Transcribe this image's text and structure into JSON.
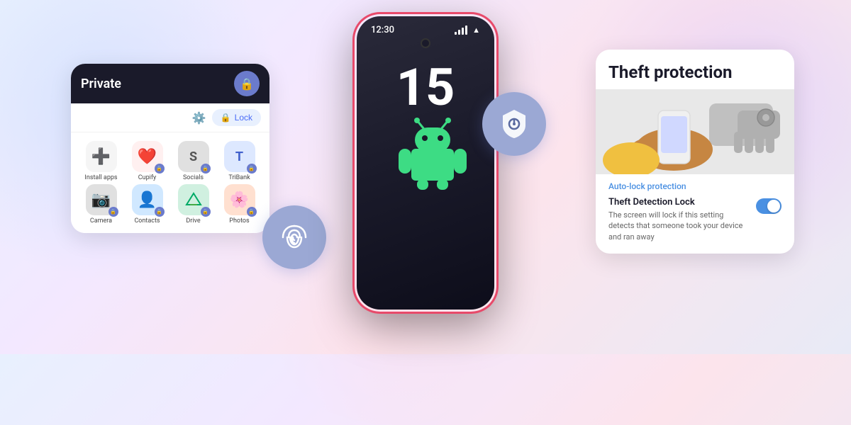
{
  "background": {
    "gradient": "linear-gradient(135deg, #e8f0fe, #f3e8ff, #fce4ec, #e8eaf6)"
  },
  "phone": {
    "time": "12:30",
    "number": "15"
  },
  "private_card": {
    "title": "Private",
    "lock_button": "Lock",
    "apps": [
      {
        "name": "Install apps",
        "icon": "+",
        "color": "#f5f5f5"
      },
      {
        "name": "Cupify",
        "icon": "❤️",
        "color": "#fff0f0"
      },
      {
        "name": "Socials",
        "icon": "S",
        "color": "#f0f0f0"
      },
      {
        "name": "TriBank",
        "icon": "T",
        "color": "#f0f5ff"
      },
      {
        "name": "Camera",
        "icon": "📷",
        "color": "#f0f0f0"
      },
      {
        "name": "Contacts",
        "icon": "👤",
        "color": "#f0f8ff"
      },
      {
        "name": "Drive",
        "icon": "▲",
        "color": "#f0fff0"
      },
      {
        "name": "Photos",
        "icon": "🌸",
        "color": "#fff5f0"
      }
    ]
  },
  "theft_card": {
    "title": "Theft protection",
    "auto_lock_label": "Auto-lock protection",
    "detection_title": "Theft Detection Lock",
    "detection_desc": "The screen will lock if this setting detects that someone took your device and ran away",
    "toggle_enabled": true
  },
  "fingerprint_bubble": {
    "aria": "fingerprint sensor"
  },
  "shield_bubble": {
    "aria": "security shield"
  }
}
